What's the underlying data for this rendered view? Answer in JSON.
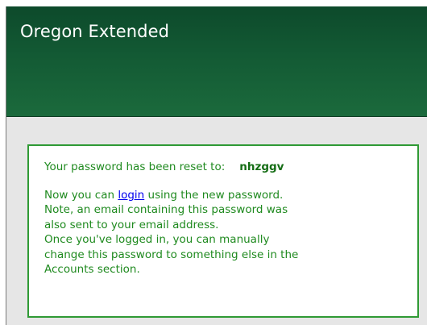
{
  "header": {
    "title": "Oregon Extended"
  },
  "message": {
    "reset_label": "Your password has been reset to:",
    "password": "nhzggv",
    "line1_before": "Now you can ",
    "login_link": "login",
    "line1_after": " using the new password.",
    "line2": "Note, an email containing this password was",
    "line3": "also sent to your email address.",
    "line4": "Once you've logged in, you can manually",
    "line5": "change this password to something else in the",
    "line6": "Accounts section."
  },
  "colors": {
    "header_green": "#135a34",
    "text_green": "#1f8a1f",
    "border_green": "#2f9a34",
    "link_blue": "#0000ee",
    "content_bg": "#e6e6e6"
  }
}
